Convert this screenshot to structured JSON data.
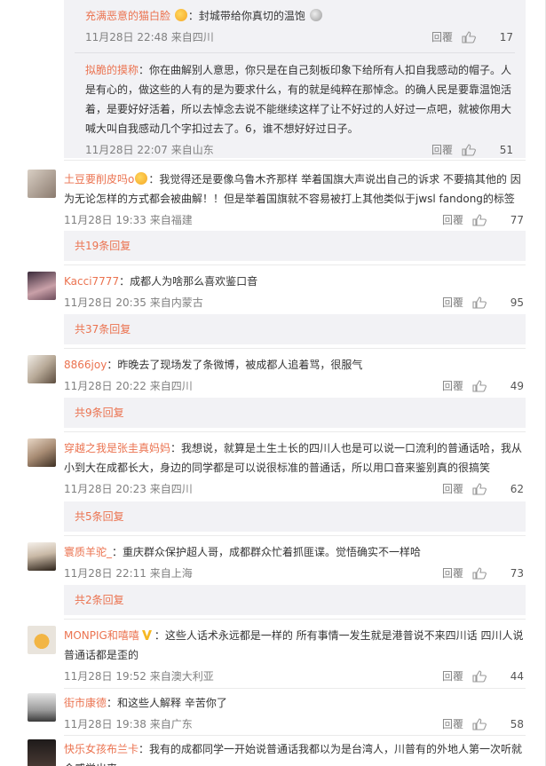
{
  "ui": {
    "reply_label": "回覆"
  },
  "sub_replies": [
    {
      "user": "充满恶意的猫白脸",
      "text": "：封城带给你真切的温饱",
      "time": "11月28日 22:48 来自四川",
      "likes": "17"
    },
    {
      "user": "拟脆的摸称",
      "text": "：你在曲解别人意思，你只是在自己刻板印象下给所有人扣自我感动的帽子。人是有心的，做这些的人有的是为要求什么，有的就是纯粹在那悼念。的确人民是要靠温饱活着，是要好好活着，所以去悼念去说不能继续这样了让不好过的人好过一点吧，就被你用大喊大叫自我感动几个字扣过去了。6，谁不想好好过日子。",
      "time": "11月28日 22:07 来自山东",
      "likes": "51"
    }
  ],
  "comments": [
    {
      "user": "土豆要削皮吗o",
      "text": "：我觉得还是要像乌鲁木齐那样 举着国旗大声说出自己的诉求 不要搞其他的 因为无论怎样的方式都会被曲解！！但是举着国旗就不容易被打上其他类似于jwsl fandong的标签",
      "time": "11月28日 19:33 来自福建",
      "likes": "77",
      "more": "共19条回复"
    },
    {
      "user": "Kacci7777",
      "text": "：成都人为啥那么喜欢鉴口音",
      "time": "11月28日 20:35 来自内蒙古",
      "likes": "95",
      "more": "共37条回复"
    },
    {
      "user": "8866joy",
      "text": "：昨晚去了现场发了条微博，被成都人追着骂，很服气",
      "time": "11月28日 20:22 来自四川",
      "likes": "49",
      "more": "共9条回复"
    },
    {
      "user": "穿越之我是张圭真妈妈",
      "text": "：我想说，就算是土生土长的四川人也是可以说一口流利的普通话哈，我从小到大在成都长大，身边的同学都是可以说很标准的普通话，所以用口音来鉴别真的很搞笑",
      "time": "11月28日 20:23 来自四川",
      "likes": "62",
      "more": "共5条回复"
    },
    {
      "user": "寰质羊驼_",
      "text": "：重庆群众保护超人哥，成都群众忙着抓匪谍。觉悟确实不一样哈",
      "time": "11月28日 22:11 来自上海",
      "likes": "73",
      "more": "共2条回复"
    },
    {
      "user": "MONPIG和嘻嘻",
      "text": "：这些人话术永远都是一样的 所有事情一发生就是港普说不来四川话 四川人说普通话都是歪的",
      "time": "11月28日 19:52 来自澳大利亚",
      "likes": "44",
      "more": ""
    },
    {
      "user": "街市康德",
      "text": "：和这些人解释 辛苦你了",
      "time": "11月28日 19:38 来自广东",
      "likes": "58",
      "more": ""
    },
    {
      "user": "快乐女孩布兰卡",
      "text": "：我有的成都同学一开始说普通话我都以为是台湾人，川普有的外地人第一次听就会感觉出来",
      "time": "",
      "likes": "",
      "more": ""
    }
  ],
  "colors": {
    "username": "#eb7350",
    "meta": "#808080",
    "panel": "#f2f2f5",
    "vip": "#f6b823"
  }
}
